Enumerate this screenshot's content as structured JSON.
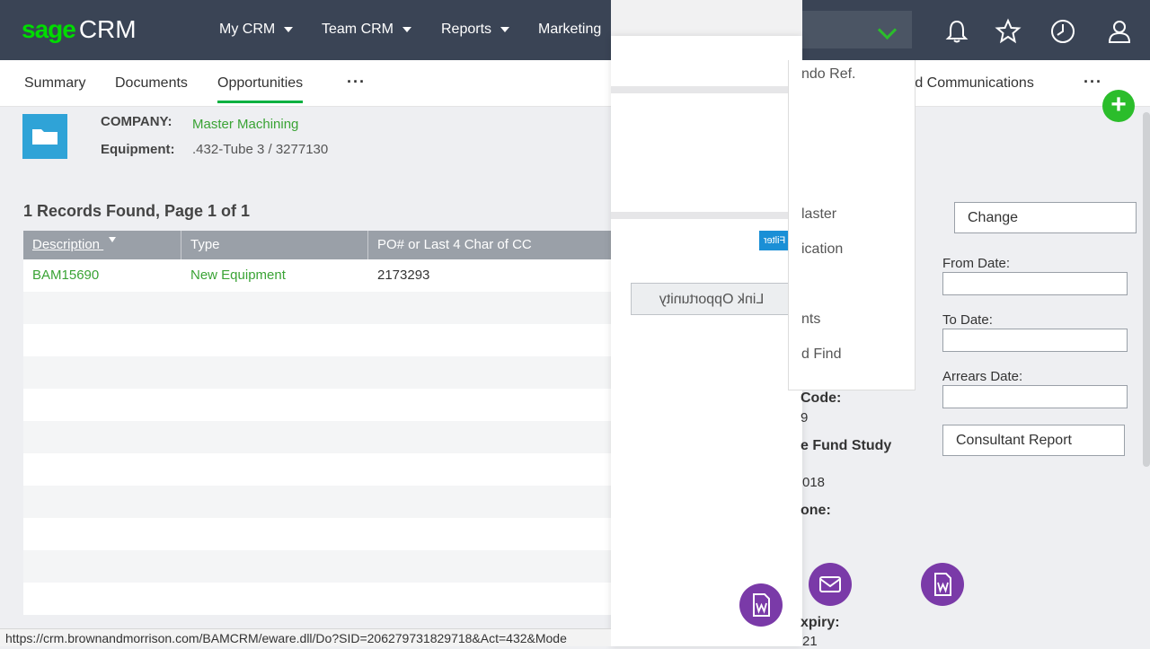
{
  "header": {
    "logo_sage": "sage",
    "logo_crm": "CRM",
    "nav": [
      {
        "label": "My CRM"
      },
      {
        "label": "Team CRM"
      },
      {
        "label": "Reports"
      },
      {
        "label": "Marketing"
      }
    ],
    "icons": [
      "bell-icon",
      "star-icon",
      "clock-icon",
      "user-icon"
    ],
    "accent_color": "#00dc00"
  },
  "tabs": {
    "summary": "Summary",
    "documents": "Documents",
    "opportunities": "Opportunities",
    "more": "···",
    "communications": "rd Communications",
    "more_right": "···"
  },
  "record": {
    "company_label": "COMPANY:",
    "company_value": "Master Machining",
    "equipment_label": "Equipment:",
    "equipment_value": ".432-Tube 3 / 3277130"
  },
  "list": {
    "records_found": "1 Records Found, Page 1 of 1",
    "columns": [
      "Description",
      "Type",
      "PO# or Last 4 Char of CC"
    ],
    "rows": [
      {
        "description": "BAM15690",
        "type": "New Equipment",
        "po": "2173293"
      }
    ]
  },
  "overlay": {
    "filter_label": "Filter",
    "link_opportunity": "Link Opportunity"
  },
  "dropdown": {
    "items": [
      "ndo Ref.",
      "laster",
      "ication",
      "nts",
      "d Find"
    ]
  },
  "partial_fields": {
    "code_label": "Code:",
    "code_value": "9",
    "fund_study": "e Fund Study",
    "year_value": "018",
    "phone_label": "one:",
    "expiry_label": "xpiry:",
    "expiry_value": "21"
  },
  "right_panel": {
    "change_button": "Change",
    "from_date_label": "From Date:",
    "from_date_value": "",
    "to_date_label": "To Date:",
    "to_date_value": "",
    "arrears_date_label": "Arrears Date:",
    "arrears_date_value": "",
    "consultant_report": "Consultant Report"
  },
  "status_bar": {
    "url": "https://crm.brownandmorrison.com/BAMCRM/eware.dll/Do?SID=206279731829718&Act=432&Mode"
  }
}
